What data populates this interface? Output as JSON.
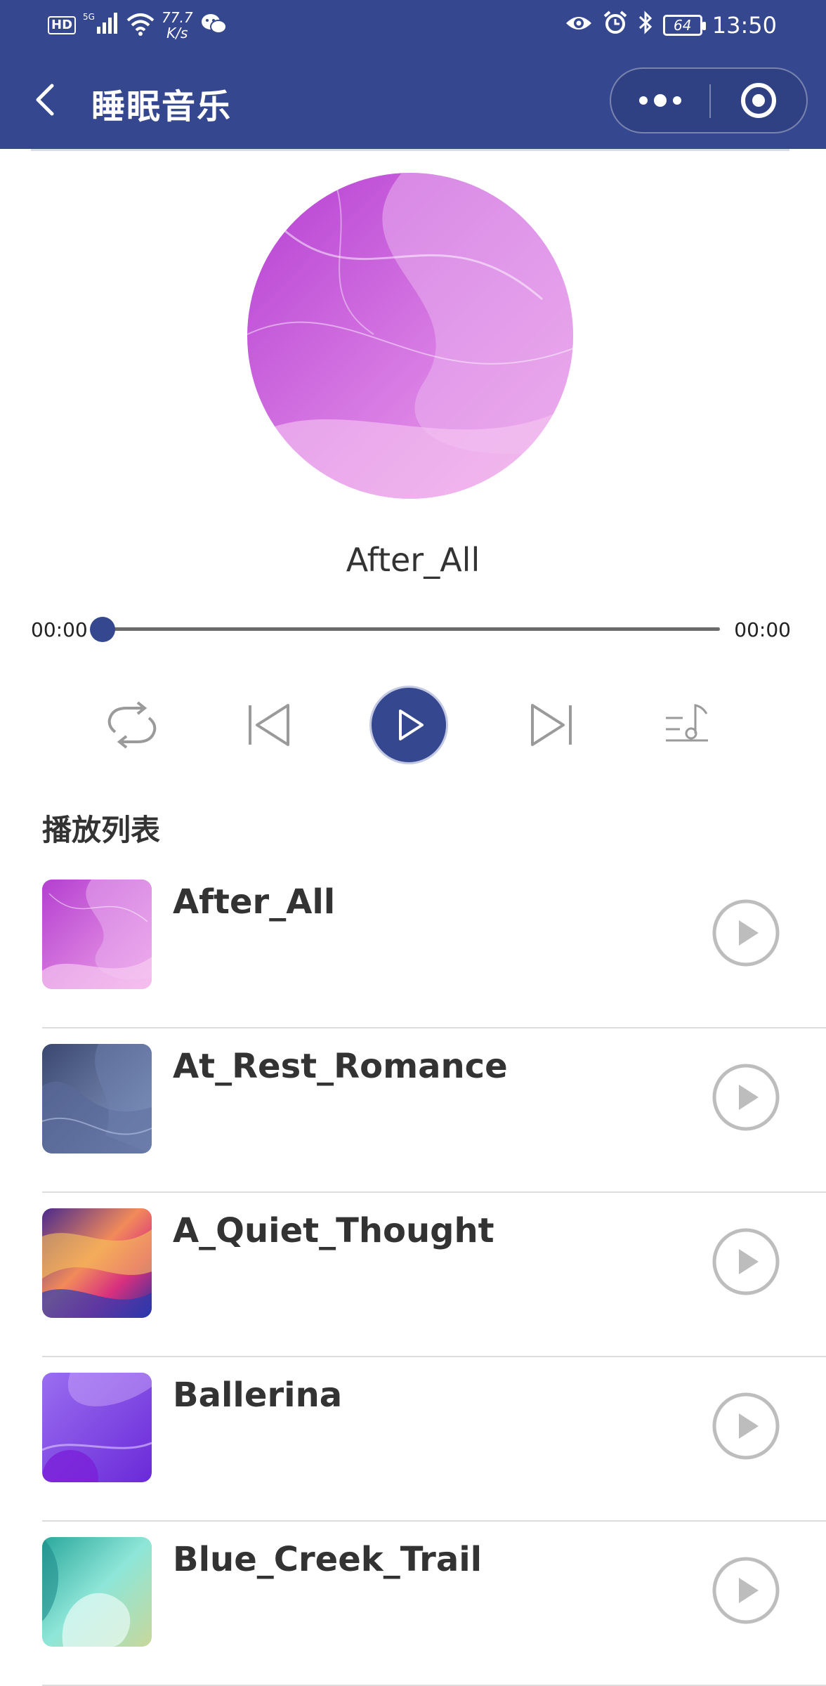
{
  "status_bar": {
    "hd": "HD",
    "net": "5G",
    "speed_value": "77.7",
    "speed_unit": "K/s",
    "battery": "64",
    "time": "13:50"
  },
  "nav": {
    "title": "睡眠音乐"
  },
  "player": {
    "current_title": "After_All",
    "time_current": "00:00",
    "time_total": "00:00",
    "progress": 0
  },
  "playlist": {
    "title": "播放列表",
    "items": [
      {
        "name": "After_All"
      },
      {
        "name": "At_Rest_Romance"
      },
      {
        "name": "A_Quiet_Thought"
      },
      {
        "name": "Ballerina"
      },
      {
        "name": "Blue_Creek_Trail"
      }
    ]
  },
  "colors": {
    "primary": "#35478f",
    "text": "#333333",
    "icon_gray": "#9a9a9a"
  }
}
